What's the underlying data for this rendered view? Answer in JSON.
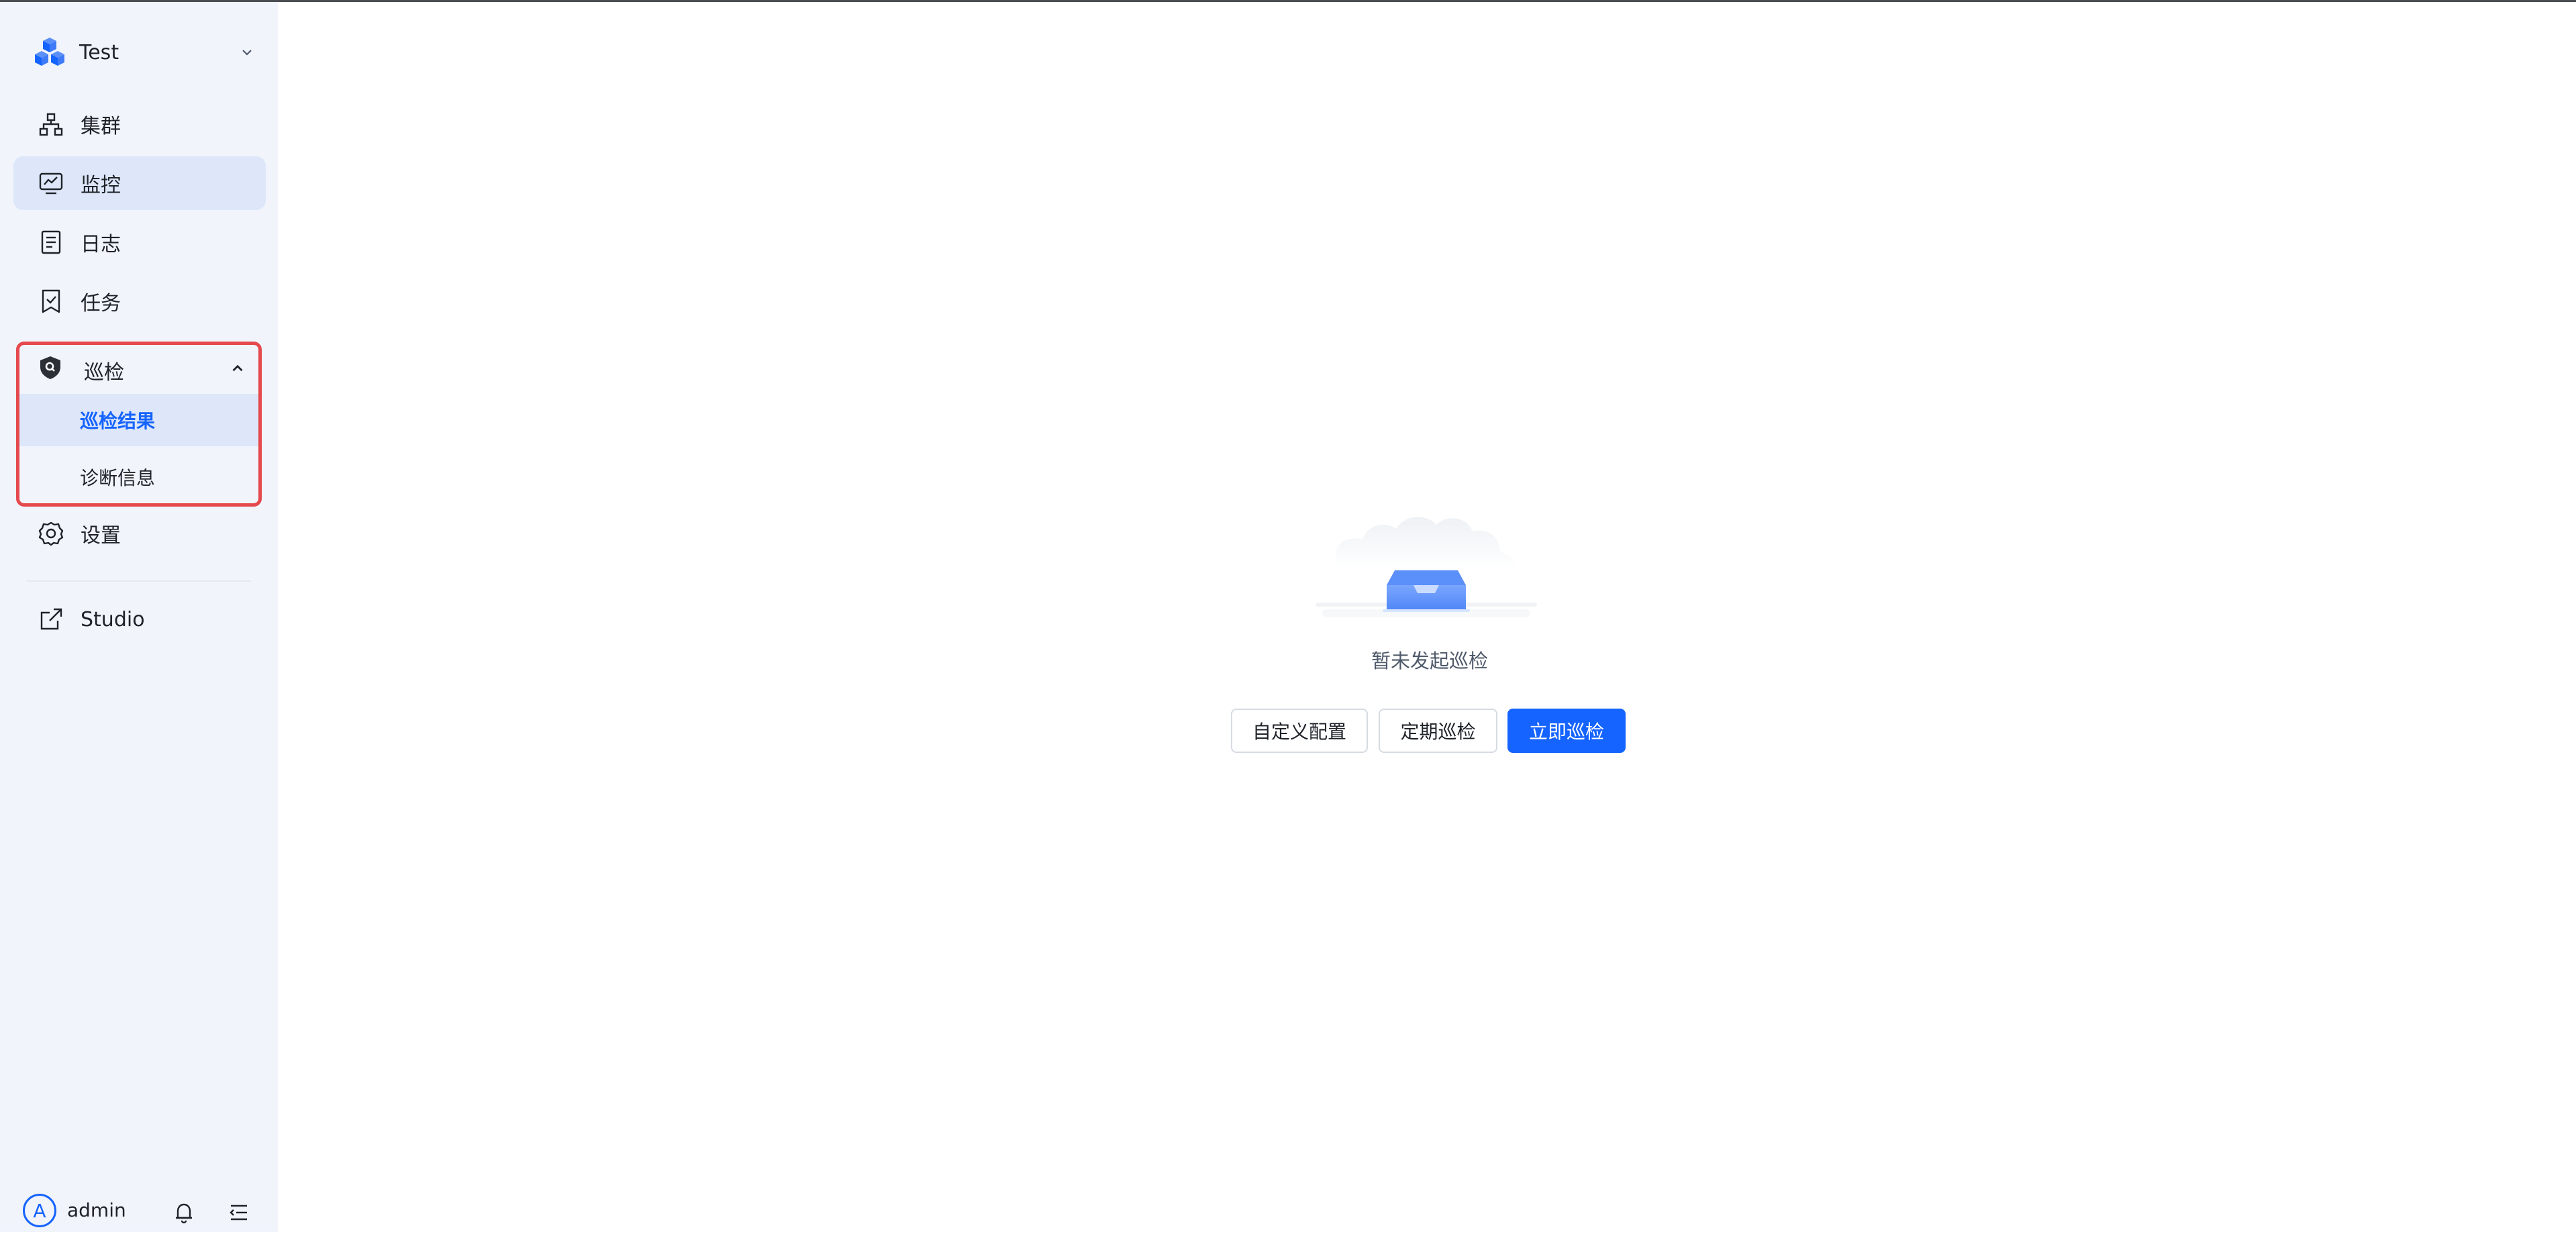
{
  "workspace": {
    "name": "Test"
  },
  "nav": {
    "cluster": "集群",
    "monitor": "监控",
    "logs": "日志",
    "tasks": "任务",
    "inspection": {
      "label": "巡检",
      "children": [
        "巡检结果",
        "诊断信息"
      ]
    },
    "settings": "设置",
    "studio": "Studio"
  },
  "user": {
    "avatar_letter": "A",
    "name": "admin"
  },
  "empty_state": {
    "message": "暂未发起巡检",
    "buttons": {
      "custom_config": "自定义配置",
      "scheduled": "定期巡检",
      "run_now": "立即巡检"
    }
  },
  "colors": {
    "primary": "#1664ff",
    "sidebar_bg": "#f1f4fb",
    "active_bg": "#dde7f9",
    "highlight_border": "#e5484d"
  }
}
